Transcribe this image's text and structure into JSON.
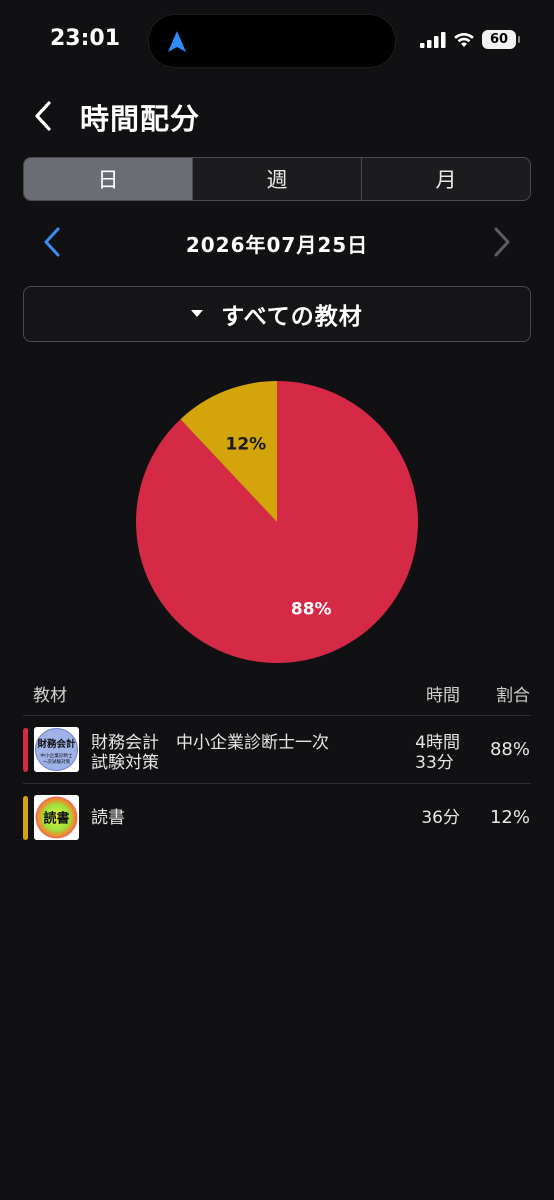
{
  "status_bar": {
    "time": "23:01",
    "battery": "60"
  },
  "header": {
    "title": "時間配分"
  },
  "tabs": [
    {
      "label": "日",
      "active": true
    },
    {
      "label": "週",
      "active": false
    },
    {
      "label": "月",
      "active": false
    }
  ],
  "date_nav": {
    "date": "2026年07月25日"
  },
  "filter": {
    "label": "すべての教材"
  },
  "chart_data": {
    "type": "pie",
    "slices": [
      {
        "name": "財務会計　中小企業診断士一次試験対策",
        "value": 88,
        "label": "88%",
        "color": "#d42a46"
      },
      {
        "name": "読書",
        "value": 12,
        "label": "12%",
        "color": "#d4a50a"
      }
    ]
  },
  "table": {
    "headers": {
      "name": "教材",
      "time": "時間",
      "ratio": "割合"
    },
    "rows": [
      {
        "name_line1": "財務会計　中小企業診断士一次",
        "name_line2": "試験対策",
        "time_line1": "4時間",
        "time_line2": "33分",
        "ratio": "88%",
        "color": "#d42a46",
        "thumb_text": "財務会計",
        "thumb_sub1": "中小企業診断士",
        "thumb_sub2": "一次試験対策"
      },
      {
        "name_line1": "読書",
        "time_line1": "36分",
        "ratio": "12%",
        "color": "#d4a50a",
        "thumb_text": "読書"
      }
    ]
  }
}
